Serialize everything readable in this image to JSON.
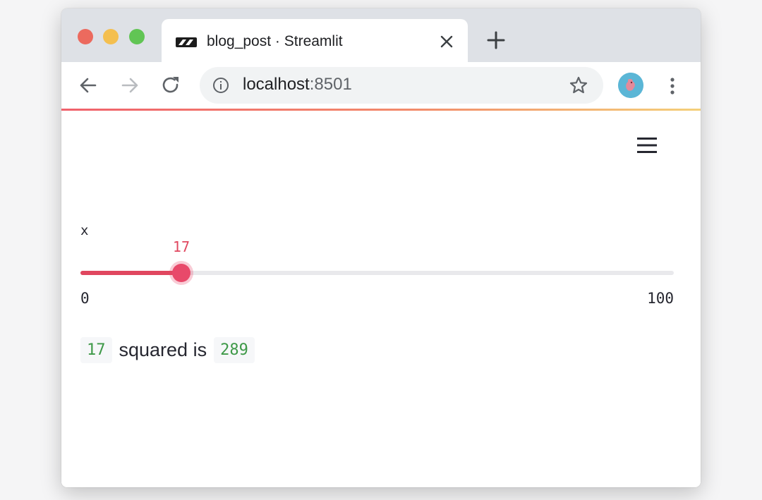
{
  "browser": {
    "tab_title": "blog_post · Streamlit",
    "url_host": "localhost",
    "url_port": ":8501",
    "icons": [
      "streamlit-logo-icon",
      "close-icon",
      "plus-icon",
      "back-arrow-icon",
      "forward-arrow-icon",
      "reload-icon",
      "info-icon",
      "star-icon",
      "profile-avatar",
      "more-vert-icon"
    ]
  },
  "app": {
    "menu_icon": "hamburger-menu-icon",
    "slider": {
      "label": "x",
      "value": 17,
      "min": 0,
      "max": 100,
      "value_text": "17",
      "min_text": "0",
      "max_text": "100"
    },
    "result": {
      "input_value": "17",
      "text": "squared is",
      "output_value": "289"
    }
  },
  "colors": {
    "accent": "#e0475f",
    "code_text": "#3e9948",
    "tabstrip": "#dee1e6"
  }
}
